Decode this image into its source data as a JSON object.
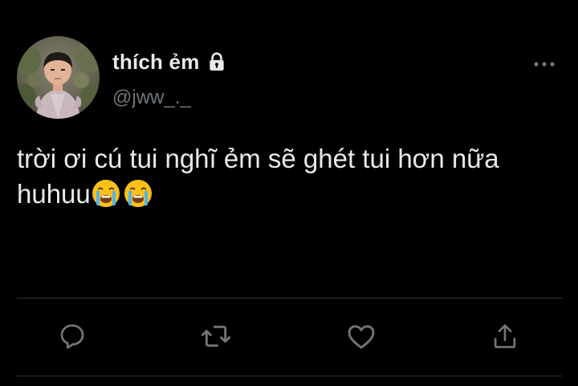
{
  "author": {
    "display_name": "thích ẻm",
    "handle": "@jww_._",
    "protected": true
  },
  "tweet": {
    "text": "trời ơi cú tui nghĩ ẻm sẽ ghét tui hơn nữa huhuu",
    "emojis": [
      "loudly-crying-face",
      "loudly-crying-face"
    ]
  },
  "actions": [
    "reply",
    "retweet",
    "like",
    "share"
  ],
  "icons": {
    "lock": "lock-icon",
    "more": "more-horizontal-icon",
    "reply": "reply-icon",
    "retweet": "retweet-icon",
    "like": "heart-icon",
    "share": "share-icon"
  },
  "colors": {
    "background": "#000000",
    "primary_text": "#e7e9ea",
    "secondary_text": "#71767b",
    "divider": "#2f3336"
  }
}
